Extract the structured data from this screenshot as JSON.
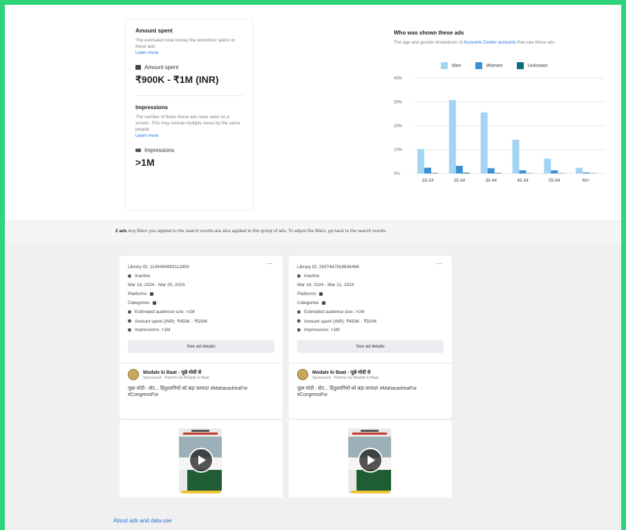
{
  "amount_spent": {
    "title": "Amount spent",
    "description": "The estimated total money the advertiser spent on these ads.",
    "learn_more": "Learn more",
    "metric_label": "Amount spent",
    "metric_value": "₹900K - ₹1M (INR)"
  },
  "impressions": {
    "title": "Impressions",
    "description": "The number of times these ads were seen on a screen. This may include multiple views by the same people.",
    "learn_more": "Learn more",
    "metric_label": "Impressions",
    "metric_value": ">1M"
  },
  "audience_chart": {
    "title": "Who was shown these ads",
    "subtitle_prefix": "The age and gender breakdown of",
    "subtitle_link": "Accounts Center accounts",
    "subtitle_suffix": "that saw these ads"
  },
  "chart_data": {
    "type": "bar",
    "categories": [
      "18-24",
      "25-34",
      "35-44",
      "45-54",
      "55-64",
      "65+"
    ],
    "series": [
      {
        "name": "Men",
        "color": "#a4d4f4",
        "values": [
          10.2,
          30.8,
          25.6,
          14.2,
          6.2,
          2.4
        ]
      },
      {
        "name": "Women",
        "color": "#3b8fd4",
        "values": [
          2.4,
          3.2,
          2.2,
          1.3,
          1.3,
          0.4
        ]
      },
      {
        "name": "Unknown",
        "color": "#0a6d79",
        "values": [
          0.2,
          0.3,
          0.2,
          0.1,
          0.1,
          0.1
        ]
      }
    ],
    "yticks": [
      "40%",
      "30%",
      "20%",
      "10%",
      "0%"
    ],
    "ylim": [
      0,
      40
    ],
    "grid": true,
    "legend_position": "top"
  },
  "filter_bar": {
    "count": "2 ads",
    "text": "Any filters you applied to the search results are also applied to this group of ads. To adjust the filters, go back to the search results."
  },
  "ads": [
    {
      "library_id": "Library ID: 1149494993112893",
      "status": "Inactive",
      "dates": "Mar 14, 2024 - Mar 20, 2024",
      "platforms": "Platforms",
      "categories": "Categories",
      "reach": "Estimated audience size: >1M",
      "spent": "Amount spent (INR): ₹450K - ₹500K",
      "impressions": "Impressions: >1M",
      "button": "See ad details",
      "page_name": "Modale ki Baat - पूछे मोदी से",
      "sponsored": "Sponsored · Paid for by Modale ki Baat",
      "text": "पूछा मोदी : वोट... हिंदुस्तानियों को बड़ा फ़ायदा! #MaharashtraFor #CongressFor"
    },
    {
      "library_id": "Library ID: 2937487918936468",
      "status": "Inactive",
      "dates": "Mar 14, 2024 - Mar 21, 2024",
      "platforms": "Platforms",
      "categories": "Categories",
      "reach": "Estimated audience size: >1M",
      "spent": "Amount spent (INR): ₹450K - ₹500K",
      "impressions": "Impressions: >1M",
      "button": "See ad details",
      "page_name": "Modale ki Baat - पूछे मोदी से",
      "sponsored": "Sponsored · Paid for by Modale ki Baat",
      "text": "पूछा मोदी : वोट... हिंदुस्तानियों को बड़ा फ़ायदा! #MaharashtraFor #CongressFor"
    }
  ],
  "footer": {
    "about_link": "About ads and data use"
  }
}
